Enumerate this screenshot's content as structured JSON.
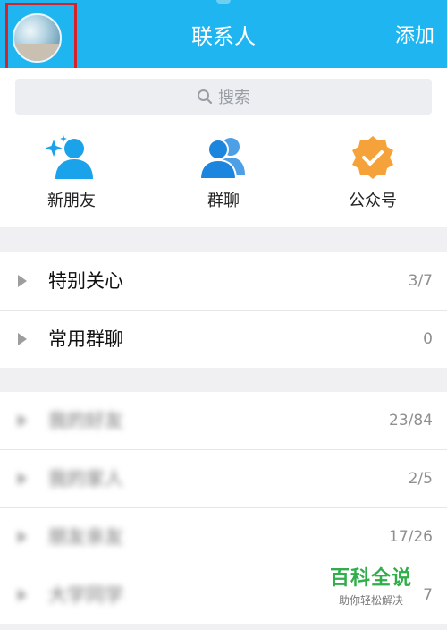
{
  "header": {
    "title": "联系人",
    "add_label": "添加",
    "accent_color": "#1fb5f0"
  },
  "search": {
    "placeholder": "搜索",
    "icon": "search-icon"
  },
  "quick_actions": [
    {
      "label": "新朋友",
      "icon": "new-friend-icon"
    },
    {
      "label": "群聊",
      "icon": "group-chat-icon"
    },
    {
      "label": "公众号",
      "icon": "official-account-icon"
    }
  ],
  "groups_top": [
    {
      "name": "特别关心",
      "count": "3/7"
    },
    {
      "name": "常用群聊",
      "count": "0"
    }
  ],
  "groups_blurred": [
    {
      "name": "我的好友",
      "count": "23/84"
    },
    {
      "name": "我的家人",
      "count": "2/5"
    },
    {
      "name": "朋友亲友",
      "count": "17/26"
    },
    {
      "name": "大学同学",
      "count": "7"
    }
  ],
  "watermark": {
    "title": "百科全说",
    "subtitle": "助你轻松解决"
  }
}
